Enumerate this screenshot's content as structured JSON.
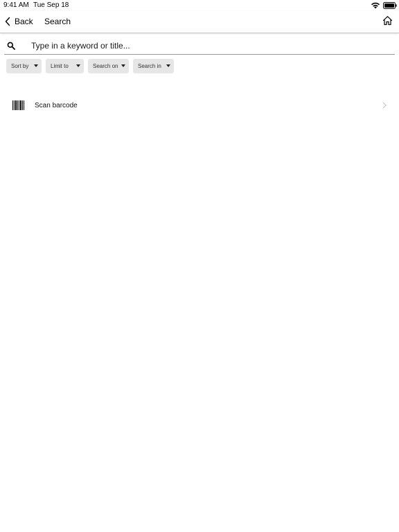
{
  "status_bar": {
    "time": "9:41 AM",
    "date": "Tue Sep 18",
    "icons": [
      "wifi-icon",
      "battery-icon"
    ]
  },
  "nav": {
    "back_label": "Back",
    "title": "Search",
    "icons": [
      "chevron-left-icon",
      "home-icon"
    ]
  },
  "search": {
    "placeholder": "Type in a keyword or title...",
    "value": "",
    "icon": "search-icon"
  },
  "filters": [
    {
      "label": "Sort by"
    },
    {
      "label": "Limit to"
    },
    {
      "label": "Search on"
    },
    {
      "label": "Search in"
    }
  ],
  "scan": {
    "label": "Scan barcode",
    "icons": [
      "barcode-icon",
      "chevron-right-icon"
    ]
  },
  "colors": {
    "chip_bg": "#e6e6e6",
    "divider": "#c8c8c8",
    "chevron": "#c7c7cc"
  }
}
